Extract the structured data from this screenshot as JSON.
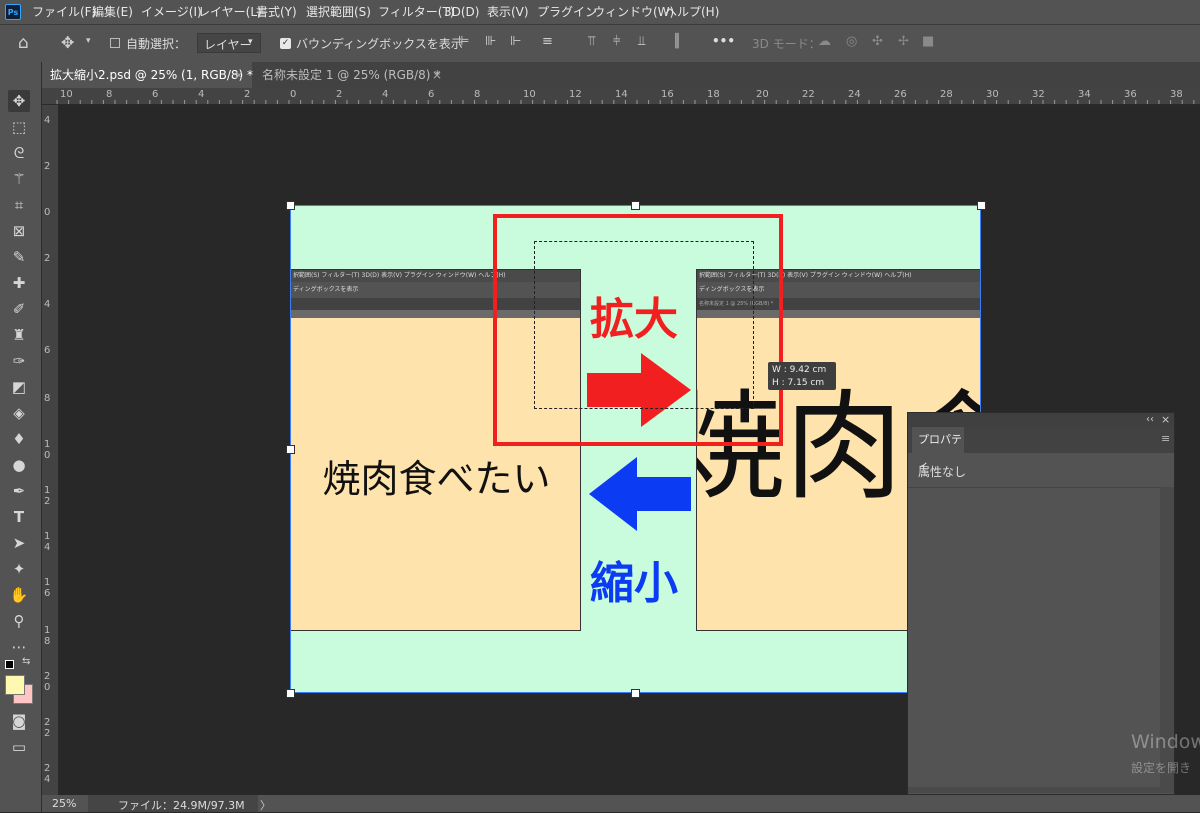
{
  "app": {
    "logo": "Ps"
  },
  "menu": [
    "ファイル(F)",
    "編集(E)",
    "イメージ(I)",
    "レイヤー(L)",
    "書式(Y)",
    "選択範囲(S)",
    "フィルター(T)",
    "3D(D)",
    "表示(V)",
    "プラグイン",
    "ウィンドウ(W)",
    "ヘルプ(H)"
  ],
  "options": {
    "auto_select_label": "自動選択：",
    "auto_select_value": "レイヤー",
    "bounding_box_label": "バウンディングボックスを表示",
    "more": "•••",
    "mode3d_label": "3D モード："
  },
  "tabs": [
    {
      "label": "拡大縮小2.psd @ 25% (1, RGB/8) *",
      "close": "×"
    },
    {
      "label": "名称未設定 1 @ 25% (RGB/8) *",
      "close": "×"
    }
  ],
  "ruler_h": [
    "10",
    "8",
    "6",
    "4",
    "2",
    "0",
    "2",
    "4",
    "6",
    "8",
    "10",
    "12",
    "14",
    "16",
    "18",
    "20",
    "22",
    "24",
    "26",
    "28",
    "30",
    "32",
    "34",
    "36",
    "38"
  ],
  "ruler_v": [
    "4",
    "2",
    "0",
    "2",
    "4",
    "6",
    "8",
    "1 0",
    "1 2",
    "1 4",
    "1 6",
    "1 8",
    "2 0",
    "2 2",
    "2 4"
  ],
  "canvas": {
    "left_text": "焼肉食べたい",
    "right_text": "焼肉食",
    "enlarge_label": "拡大",
    "shrink_label": "縮小",
    "mini_menu": "択範囲(S)  フィルター(T)  3D(D)  表示(V)  プラグイン  ウィンドウ(W)  ヘルプ(H)",
    "mini_opt": "ディングボックスを表示",
    "mini_tab": "名称未設定 1 @ 25% (RGB/8) *",
    "colors": {
      "bg": "#c9fcdc",
      "panel": "#ffe3ad",
      "red": "#f11f1f",
      "blue": "#0c3bf4"
    }
  },
  "tooltip": {
    "w": "W : 9.42 cm",
    "h": "H : 7.15 cm"
  },
  "status": {
    "zoom": "25%",
    "file": "ファイル：24.9M/97.3M",
    "arrow": "〉"
  },
  "properties": {
    "tab": "プロパティ",
    "body": "属性なし",
    "collapse": "‹‹",
    "close": "×",
    "menu": "≡"
  },
  "watermark": {
    "line1": "Window",
    "line2": "設定を開き"
  },
  "icons": [
    "home-icon",
    "move-icon",
    "chevron-down-icon",
    "align-left-icon",
    "align-center-icon",
    "align-right-icon",
    "distribute-icon",
    "orbit-icon",
    "roll-icon",
    "pan-icon",
    "slide-icon",
    "camera-icon"
  ]
}
